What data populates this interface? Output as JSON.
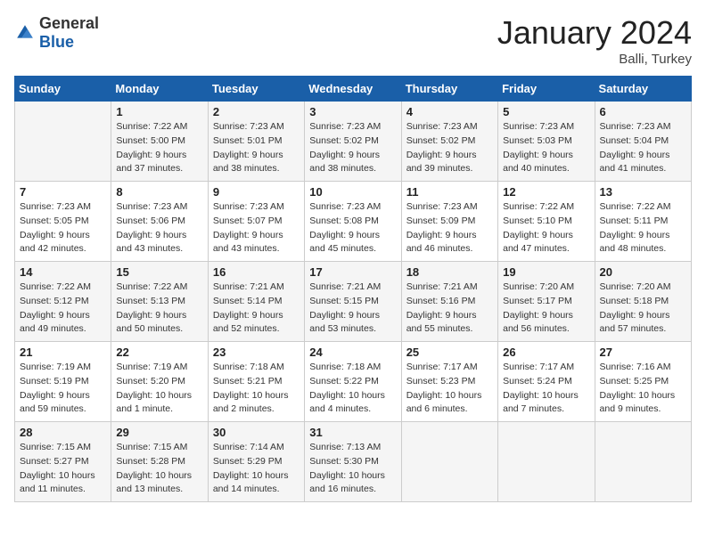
{
  "logo": {
    "general": "General",
    "blue": "Blue"
  },
  "title": "January 2024",
  "location": "Balli, Turkey",
  "days_header": [
    "Sunday",
    "Monday",
    "Tuesday",
    "Wednesday",
    "Thursday",
    "Friday",
    "Saturday"
  ],
  "weeks": [
    [
      {
        "day": "",
        "detail": ""
      },
      {
        "day": "1",
        "detail": "Sunrise: 7:22 AM\nSunset: 5:00 PM\nDaylight: 9 hours\nand 37 minutes."
      },
      {
        "day": "2",
        "detail": "Sunrise: 7:23 AM\nSunset: 5:01 PM\nDaylight: 9 hours\nand 38 minutes."
      },
      {
        "day": "3",
        "detail": "Sunrise: 7:23 AM\nSunset: 5:02 PM\nDaylight: 9 hours\nand 38 minutes."
      },
      {
        "day": "4",
        "detail": "Sunrise: 7:23 AM\nSunset: 5:02 PM\nDaylight: 9 hours\nand 39 minutes."
      },
      {
        "day": "5",
        "detail": "Sunrise: 7:23 AM\nSunset: 5:03 PM\nDaylight: 9 hours\nand 40 minutes."
      },
      {
        "day": "6",
        "detail": "Sunrise: 7:23 AM\nSunset: 5:04 PM\nDaylight: 9 hours\nand 41 minutes."
      }
    ],
    [
      {
        "day": "7",
        "detail": "Sunrise: 7:23 AM\nSunset: 5:05 PM\nDaylight: 9 hours\nand 42 minutes."
      },
      {
        "day": "8",
        "detail": "Sunrise: 7:23 AM\nSunset: 5:06 PM\nDaylight: 9 hours\nand 43 minutes."
      },
      {
        "day": "9",
        "detail": "Sunrise: 7:23 AM\nSunset: 5:07 PM\nDaylight: 9 hours\nand 43 minutes."
      },
      {
        "day": "10",
        "detail": "Sunrise: 7:23 AM\nSunset: 5:08 PM\nDaylight: 9 hours\nand 45 minutes."
      },
      {
        "day": "11",
        "detail": "Sunrise: 7:23 AM\nSunset: 5:09 PM\nDaylight: 9 hours\nand 46 minutes."
      },
      {
        "day": "12",
        "detail": "Sunrise: 7:22 AM\nSunset: 5:10 PM\nDaylight: 9 hours\nand 47 minutes."
      },
      {
        "day": "13",
        "detail": "Sunrise: 7:22 AM\nSunset: 5:11 PM\nDaylight: 9 hours\nand 48 minutes."
      }
    ],
    [
      {
        "day": "14",
        "detail": "Sunrise: 7:22 AM\nSunset: 5:12 PM\nDaylight: 9 hours\nand 49 minutes."
      },
      {
        "day": "15",
        "detail": "Sunrise: 7:22 AM\nSunset: 5:13 PM\nDaylight: 9 hours\nand 50 minutes."
      },
      {
        "day": "16",
        "detail": "Sunrise: 7:21 AM\nSunset: 5:14 PM\nDaylight: 9 hours\nand 52 minutes."
      },
      {
        "day": "17",
        "detail": "Sunrise: 7:21 AM\nSunset: 5:15 PM\nDaylight: 9 hours\nand 53 minutes."
      },
      {
        "day": "18",
        "detail": "Sunrise: 7:21 AM\nSunset: 5:16 PM\nDaylight: 9 hours\nand 55 minutes."
      },
      {
        "day": "19",
        "detail": "Sunrise: 7:20 AM\nSunset: 5:17 PM\nDaylight: 9 hours\nand 56 minutes."
      },
      {
        "day": "20",
        "detail": "Sunrise: 7:20 AM\nSunset: 5:18 PM\nDaylight: 9 hours\nand 57 minutes."
      }
    ],
    [
      {
        "day": "21",
        "detail": "Sunrise: 7:19 AM\nSunset: 5:19 PM\nDaylight: 9 hours\nand 59 minutes."
      },
      {
        "day": "22",
        "detail": "Sunrise: 7:19 AM\nSunset: 5:20 PM\nDaylight: 10 hours\nand 1 minute."
      },
      {
        "day": "23",
        "detail": "Sunrise: 7:18 AM\nSunset: 5:21 PM\nDaylight: 10 hours\nand 2 minutes."
      },
      {
        "day": "24",
        "detail": "Sunrise: 7:18 AM\nSunset: 5:22 PM\nDaylight: 10 hours\nand 4 minutes."
      },
      {
        "day": "25",
        "detail": "Sunrise: 7:17 AM\nSunset: 5:23 PM\nDaylight: 10 hours\nand 6 minutes."
      },
      {
        "day": "26",
        "detail": "Sunrise: 7:17 AM\nSunset: 5:24 PM\nDaylight: 10 hours\nand 7 minutes."
      },
      {
        "day": "27",
        "detail": "Sunrise: 7:16 AM\nSunset: 5:25 PM\nDaylight: 10 hours\nand 9 minutes."
      }
    ],
    [
      {
        "day": "28",
        "detail": "Sunrise: 7:15 AM\nSunset: 5:27 PM\nDaylight: 10 hours\nand 11 minutes."
      },
      {
        "day": "29",
        "detail": "Sunrise: 7:15 AM\nSunset: 5:28 PM\nDaylight: 10 hours\nand 13 minutes."
      },
      {
        "day": "30",
        "detail": "Sunrise: 7:14 AM\nSunset: 5:29 PM\nDaylight: 10 hours\nand 14 minutes."
      },
      {
        "day": "31",
        "detail": "Sunrise: 7:13 AM\nSunset: 5:30 PM\nDaylight: 10 hours\nand 16 minutes."
      },
      {
        "day": "",
        "detail": ""
      },
      {
        "day": "",
        "detail": ""
      },
      {
        "day": "",
        "detail": ""
      }
    ]
  ]
}
